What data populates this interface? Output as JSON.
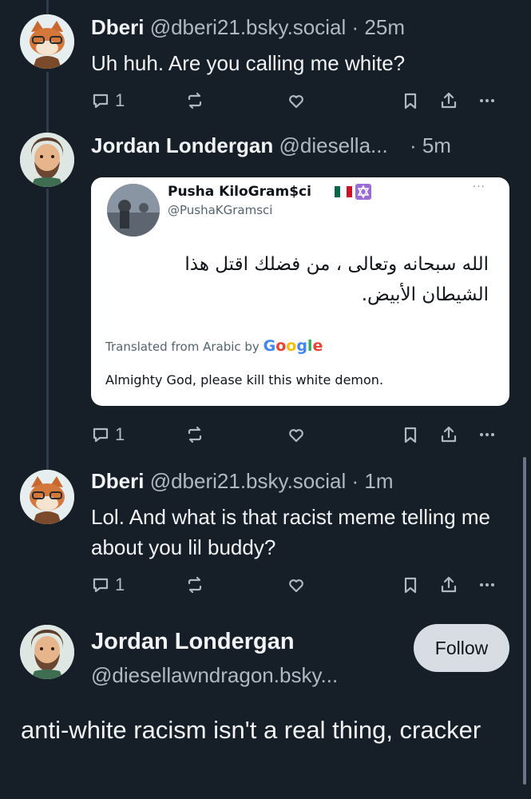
{
  "posts": [
    {
      "name": "Dberi",
      "handle": "@dberi21.bsky.social",
      "time": "· 25m",
      "text": "Uh huh. Are you calling me white?",
      "reply_count": "1"
    },
    {
      "name": "Jordan Londergan",
      "handle": "@diesella...",
      "time": "· 5m",
      "reply_count": "1",
      "embed": {
        "name": "Pusha KiloGram$ci",
        "handle": "@PushaKGramsci",
        "dots": "···",
        "arabic": "الله سبحانه وتعالى ، من فضلك اقتل هذا الشيطان الأبيض.",
        "translated_prefix": "Translated from Arabic by",
        "google": "Google",
        "translation": "Almighty God, please kill this white demon."
      }
    },
    {
      "name": "Dberi",
      "handle": "@dberi21.bsky.social",
      "time": "· 1m",
      "text": "Lol. And what is that racist meme telling me about you lil buddy?",
      "reply_count": "1"
    }
  ],
  "main_post": {
    "name": "Jordan Londergan",
    "handle": "@diesellawndragon.bsky...",
    "follow_label": "Follow",
    "text": "anti-white racism isn't a real thing, cracker"
  },
  "icons": [
    "reply-icon",
    "repost-icon",
    "like-icon",
    "bookmark-icon",
    "share-icon",
    "more-icon"
  ],
  "colors": {
    "background": "#161e27",
    "text": "#f1f3f5",
    "muted": "#aeb9c4",
    "follow_bg": "#d7dde3"
  }
}
